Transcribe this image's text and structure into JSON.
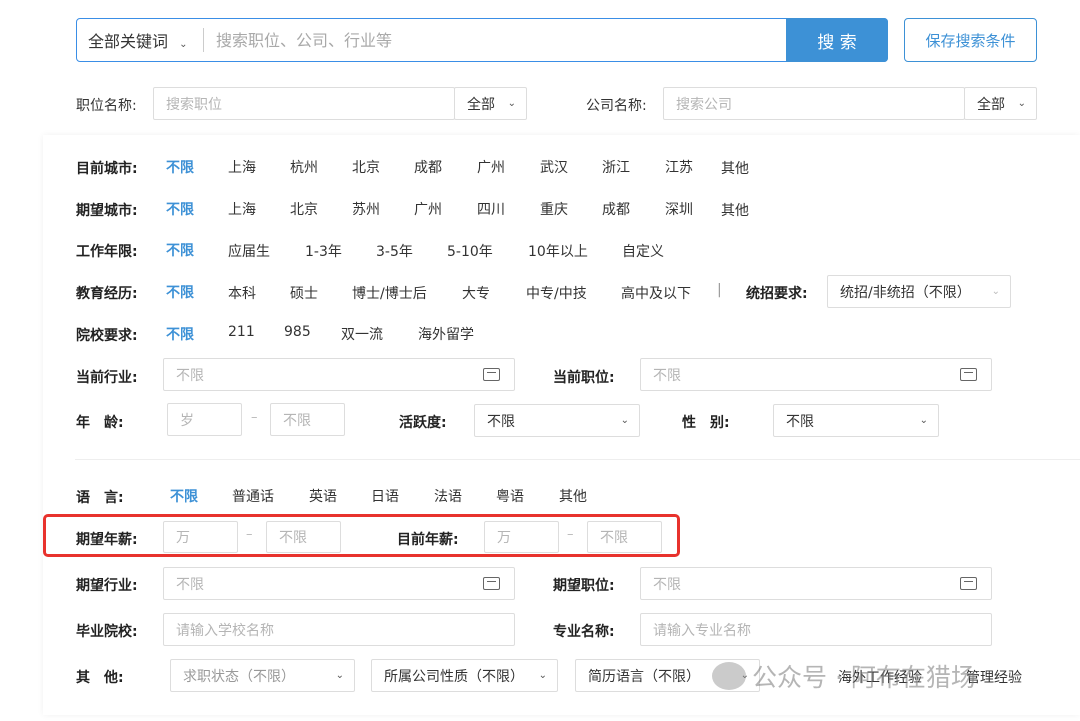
{
  "search": {
    "keyword_type": "全部关键词",
    "placeholder": "搜索职位、公司、行业等",
    "button": "搜 索",
    "save_button": "保存搜索条件"
  },
  "position": {
    "label": "职位名称:",
    "placeholder": "搜索职位",
    "scope": "全部"
  },
  "company": {
    "label": "公司名称:",
    "placeholder": "搜索公司",
    "scope": "全部"
  },
  "filters": {
    "current_city": {
      "label": "目前城市:",
      "options": [
        "不限",
        "上海",
        "杭州",
        "北京",
        "成都",
        "广州",
        "武汉",
        "浙江",
        "江苏",
        "其他"
      ]
    },
    "expected_city": {
      "label": "期望城市:",
      "options": [
        "不限",
        "上海",
        "北京",
        "苏州",
        "广州",
        "四川",
        "重庆",
        "成都",
        "深圳",
        "其他"
      ]
    },
    "work_years": {
      "label": "工作年限:",
      "options": [
        "不限",
        "应届生",
        "1-3年",
        "3-5年",
        "5-10年",
        "10年以上",
        "自定义"
      ]
    },
    "education": {
      "label": "教育经历:",
      "options": [
        "不限",
        "本科",
        "硕士",
        "博士/博士后",
        "大专",
        "中专/中技",
        "高中及以下"
      ],
      "separator": "|",
      "unified_label": "统招要求:",
      "unified_value": "统招/非统招（不限）"
    },
    "school": {
      "label": "院校要求:",
      "options": [
        "不限",
        "211",
        "985",
        "双一流",
        "海外留学"
      ]
    },
    "current_industry": {
      "label": "当前行业:",
      "value": "不限"
    },
    "current_position": {
      "label": "当前职位:",
      "value": "不限"
    },
    "age": {
      "label": "年　龄:",
      "min_placeholder": "岁",
      "dash": "–",
      "max_placeholder": "不限"
    },
    "activity": {
      "label": "活跃度:",
      "value": "不限"
    },
    "gender": {
      "label": "性　别:",
      "value": "不限"
    },
    "language": {
      "label": "语　言:",
      "options": [
        "不限",
        "普通话",
        "英语",
        "日语",
        "法语",
        "粤语",
        "其他"
      ]
    },
    "expected_salary": {
      "label": "期望年薪:",
      "min_placeholder": "万",
      "dash": "–",
      "max_placeholder": "不限"
    },
    "current_salary": {
      "label": "目前年薪:",
      "min_placeholder": "万",
      "dash": "–",
      "max_placeholder": "不限"
    },
    "expected_industry": {
      "label": "期望行业:",
      "value": "不限"
    },
    "expected_position": {
      "label": "期望职位:",
      "value": "不限"
    },
    "graduate_school": {
      "label": "毕业院校:",
      "placeholder": "请输入学校名称"
    },
    "major": {
      "label": "专业名称:",
      "placeholder": "请输入专业名称"
    },
    "other": {
      "label": "其　他:",
      "job_status": "求职状态（不限）",
      "company_type": "所属公司性质（不限）",
      "resume_language": "简历语言（不限）",
      "overseas": "海外工作经验",
      "management": "管理经验"
    }
  },
  "watermark": "公众号 · 阿布在猎场",
  "colors": {
    "accent": "#3d91d6",
    "highlight_border": "#e8322d"
  }
}
